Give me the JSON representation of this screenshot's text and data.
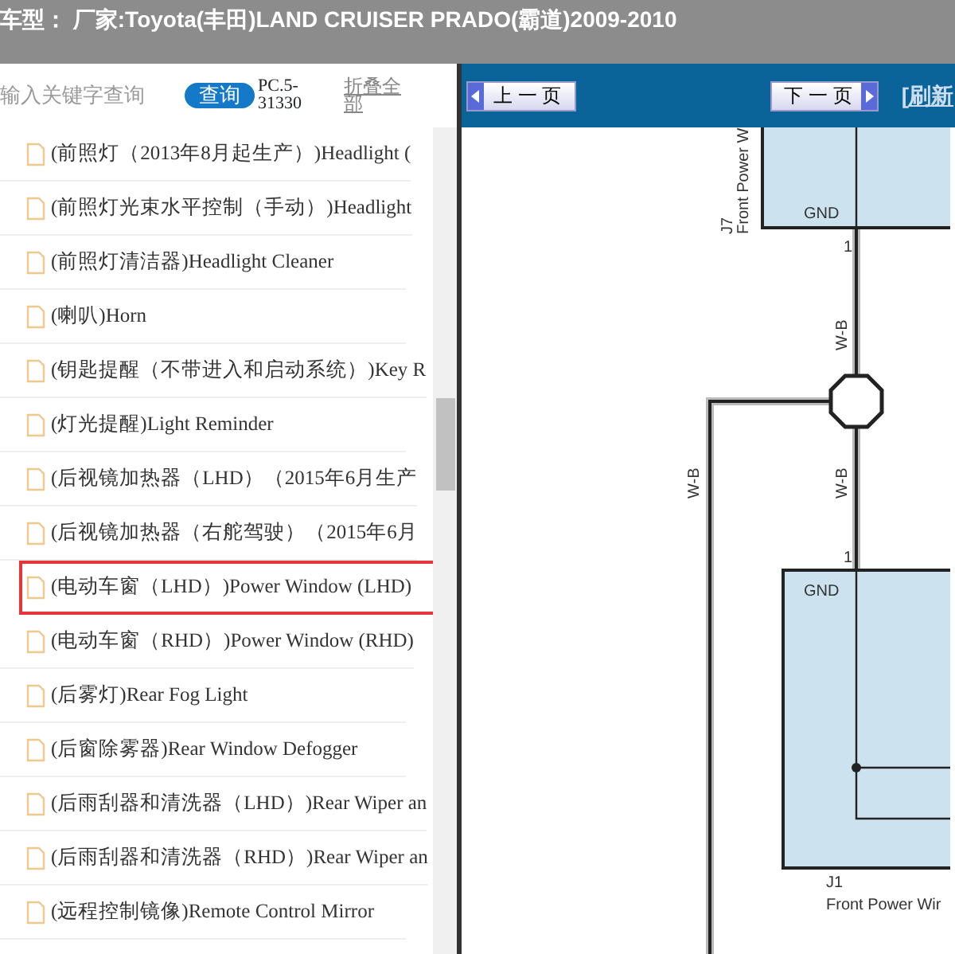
{
  "header": {
    "title": "车型：  厂家:Toyota(丰田)LAND CRUISER PRADO(霸道)2009-2010"
  },
  "search": {
    "placeholder": "输入关键字查询",
    "button": "查询",
    "code": "PC.5-31330",
    "collapse": "折叠全部"
  },
  "tree": {
    "items": [
      {
        "label": "(前照灯（2013年8月起生产）)Headlight (",
        "selected": false
      },
      {
        "label": "(前照灯光束水平控制（手动）)Headlight",
        "selected": false
      },
      {
        "label": "(前照灯清洁器)Headlight Cleaner",
        "selected": false
      },
      {
        "label": "(喇叭)Horn",
        "selected": false
      },
      {
        "label": "(钥匙提醒（不带进入和启动系统）)Key R",
        "selected": false
      },
      {
        "label": "(灯光提醒)Light Reminder",
        "selected": false
      },
      {
        "label": "(后视镜加热器（LHD）（2015年6月生产",
        "selected": false
      },
      {
        "label": "(后视镜加热器（右舵驾驶）（2015年6月",
        "selected": false
      },
      {
        "label": "(电动车窗（LHD）)Power Window (LHD)",
        "selected": true
      },
      {
        "label": "(电动车窗（RHD）)Power Window (RHD)",
        "selected": false
      },
      {
        "label": "(后雾灯)Rear Fog Light",
        "selected": false
      },
      {
        "label": "(后窗除雾器)Rear Window Defogger",
        "selected": false
      },
      {
        "label": "(后雨刮器和清洗器（LHD）)Rear Wiper an",
        "selected": false
      },
      {
        "label": "(后雨刮器和清洗器（RHD）)Rear Wiper an",
        "selected": false
      },
      {
        "label": "(远程控制镜像)Remote Control Mirror",
        "selected": false
      }
    ]
  },
  "toolbar": {
    "prev": "上 一 页",
    "next": "下 一 页",
    "refresh": "[刷新"
  },
  "diagram": {
    "connectors": [
      {
        "code": "J7",
        "name": "Front Power W",
        "pin_label": "GND",
        "pin": "1"
      },
      {
        "code": "J1",
        "name": "Front Power Wir",
        "pin_label": "GND",
        "pin": "1"
      }
    ],
    "wires": [
      "W-B",
      "W-B",
      "W-B"
    ]
  }
}
